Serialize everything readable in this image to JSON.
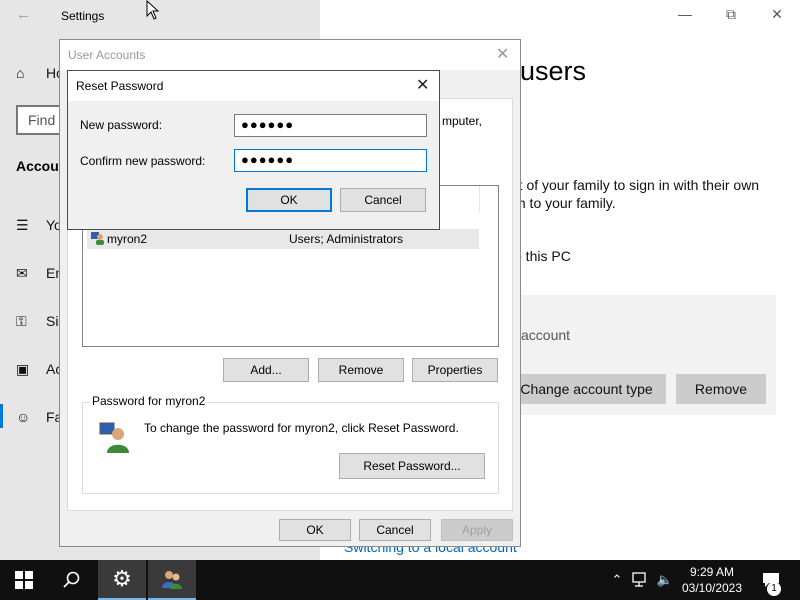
{
  "settings": {
    "title": "Settings",
    "nav": {
      "home": "Ho",
      "find": "Find a",
      "section": "Accou",
      "your_info": "Yo",
      "email": "En",
      "sign_in": "Sig",
      "access": "Ac",
      "family": "Fa"
    },
    "page_title": "users",
    "desc_line1": "rt of your family to sign in with their own",
    "desc_line2": "m to your family.",
    "add_text": "o this PC",
    "account_label": "l account",
    "change_type_button": "Change account type",
    "remove_button": "Remove",
    "link": "Switching to a local account",
    "accent_color": "#0078d7"
  },
  "user_accounts": {
    "title": "User Accounts",
    "header_text": "mputer,",
    "list": [
      {
        "name": "myron2",
        "group": "Users; Administrators"
      }
    ],
    "buttons": {
      "add": "Add...",
      "remove": "Remove",
      "properties": "Properties"
    },
    "password_group": {
      "legend": "Password for myron2",
      "text": "To change the password for myron2, click Reset Password.",
      "reset_button": "Reset Password..."
    },
    "footer": {
      "ok": "OK",
      "cancel": "Cancel",
      "apply": "Apply"
    }
  },
  "reset_password": {
    "title": "Reset Password",
    "new_password_label": "New password:",
    "new_password_value": "●●●●●●",
    "confirm_label": "Confirm new password:",
    "confirm_value": "●●●●●●",
    "ok": "OK",
    "cancel": "Cancel"
  },
  "taskbar": {
    "time": "9:29 AM",
    "date": "03/10/2023",
    "notification_count": "1"
  }
}
